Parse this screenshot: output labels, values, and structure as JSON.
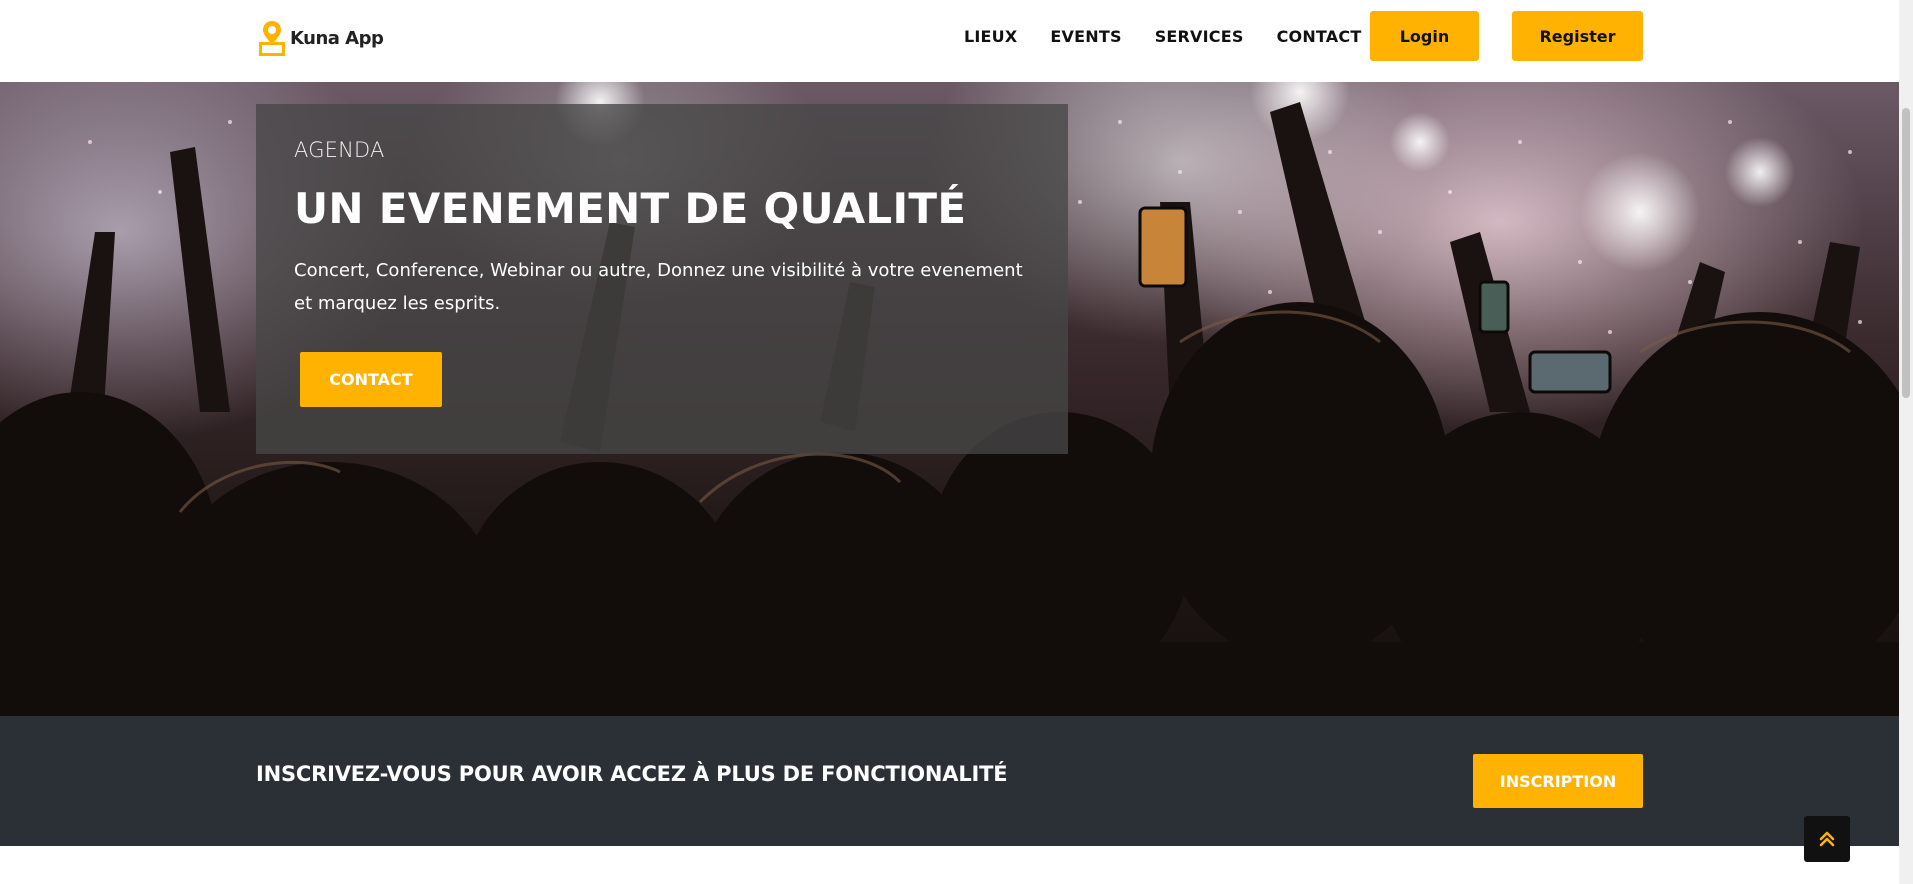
{
  "brand": {
    "name": "Kuna App",
    "logo_icon": "map-pin-icon"
  },
  "nav": {
    "links": [
      "LIEUX",
      "EVENTS",
      "SERVICES",
      "CONTACT"
    ],
    "login_label": "Login",
    "register_label": "Register"
  },
  "hero": {
    "eyebrow": "AGENDA",
    "title": "UN EVENEMENT DE QUALITÉ",
    "text": "Concert, Conference, Webinar ou autre, Donnez une visibilité à votre evenement et marquez les esprits.",
    "button_label": "CONTACT"
  },
  "band": {
    "text": "INSCRIVEZ-VOUS POUR AVOIR ACCEZ À PLUS DE FONCTIONALITÉ",
    "button_label": "INSCRIPTION"
  },
  "back_to_top_icon": "double-chevron-up-icon",
  "colors": {
    "accent": "#ffb300",
    "band_bg": "#2b2f36",
    "nav_text": "#111111"
  }
}
